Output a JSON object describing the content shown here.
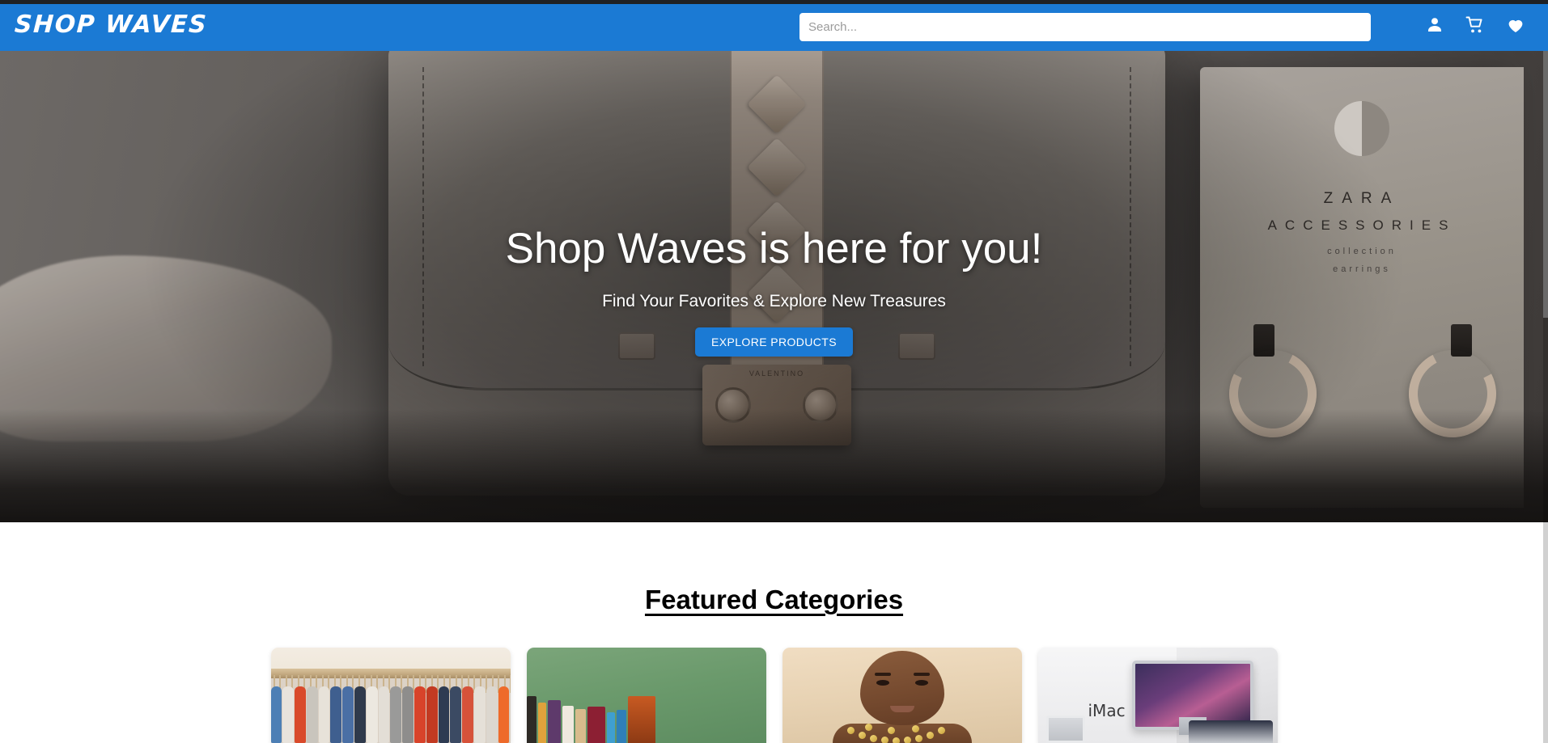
{
  "header": {
    "logo": "SHOP WAVES",
    "search": {
      "placeholder": "Search...",
      "value": ""
    },
    "icons": [
      {
        "name": "account-icon",
        "label": "Account"
      },
      {
        "name": "cart-icon",
        "label": "Cart"
      },
      {
        "name": "wishlist-icon",
        "label": "Wishlist"
      }
    ],
    "colors": {
      "bar": "#1b7ad4",
      "top_strip": "#1f2124",
      "text": "#ffffff"
    }
  },
  "hero": {
    "title": "Shop Waves is here for you!",
    "subtitle": "Find Your Favorites & Explore New Treasures",
    "cta_label": "EXPLORE PRODUCTS",
    "cta_color": "#1b7ad4",
    "background_description": "Gray leather handbag with studded strap and chain on a table, next to a ZARA accessories box with hoop earrings",
    "background_text": {
      "brand": "ZARA",
      "line2": "ACCESSORIES",
      "line3": "collection",
      "line4": "earrings"
    }
  },
  "featured": {
    "title": "Featured Categories",
    "cards": [
      {
        "name": "category-card-clothing",
        "alt": "Clothing on hangers"
      },
      {
        "name": "category-card-books",
        "alt": "Books against green chalkboard"
      },
      {
        "name": "category-card-jewelry",
        "alt": "Woman wearing gold jewelry"
      },
      {
        "name": "category-card-electronics",
        "alt": "iMac and Apple devices"
      }
    ]
  }
}
